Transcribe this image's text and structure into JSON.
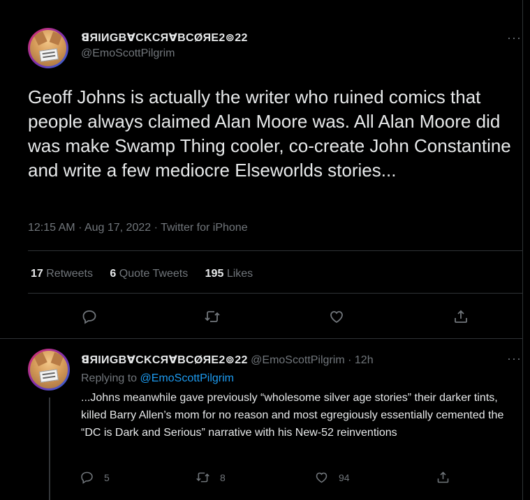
{
  "main_tweet": {
    "display_name": "ꓭЯIИGBⱯCKCЯⱯBCØЯE2⊚22",
    "handle": "@EmoScottPilgrim",
    "more": "···",
    "text": "Geoff Johns is actually the writer who ruined comics that people always claimed Alan Moore was. All Alan Moore did was make Swamp Thing cooler, co-create John Constantine and write a few mediocre Elseworlds stories...",
    "time": "12:15 AM",
    "date": "Aug 17, 2022",
    "source": "Twitter for iPhone",
    "stats": {
      "retweets_count": "17",
      "retweets_label": "Retweets",
      "quotes_count": "6",
      "quotes_label": "Quote Tweets",
      "likes_count": "195",
      "likes_label": "Likes"
    },
    "actions": [
      "reply-icon",
      "retweet-icon",
      "like-icon",
      "share-icon"
    ]
  },
  "reply_tweet": {
    "display_name": "ꓭЯIИGBⱯCKCЯⱯBCØЯE2⊚22",
    "handle": "@EmoScottPilgrim",
    "separator": "·",
    "age": "12h",
    "more": "···",
    "replying_prefix": "Replying to",
    "replying_to": "@EmoScottPilgrim",
    "text": "...Johns meanwhile gave previously “wholesome silver age stories” their darker tints, killed Barry Allen’s mom for no reason and most egregiously essentially cemented the “DC is Dark and Serious” narrative with his New-52 reinventions",
    "counts": {
      "replies": "5",
      "retweets": "8",
      "likes": "94"
    }
  },
  "colors": {
    "background": "#000000",
    "text": "#e7e9ea",
    "muted": "#71767b",
    "link": "#1d9bf0",
    "border": "#2f3336"
  }
}
